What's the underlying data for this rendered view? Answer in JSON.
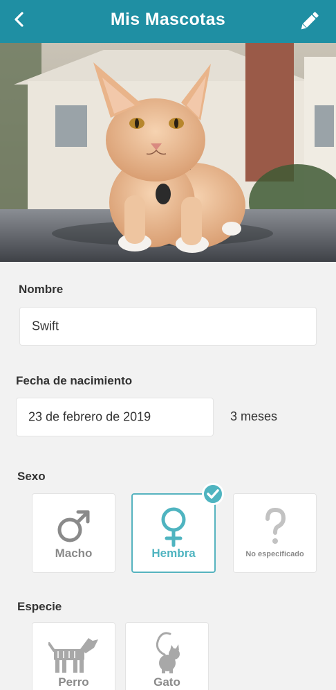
{
  "header": {
    "title": "Mis Mascotas",
    "back_icon": "chevron-left-icon",
    "edit_icon": "pencil-icon",
    "bg_color": "#1f8fa3"
  },
  "photo": {
    "subject": "cat"
  },
  "form": {
    "name": {
      "label": "Nombre",
      "value": "Swift"
    },
    "birth": {
      "label": "Fecha de nacimiento",
      "value": "23 de febrero de 2019",
      "age": "3 meses"
    },
    "sex": {
      "label": "Sexo",
      "selected": "Hembra",
      "options": [
        {
          "label": "Macho",
          "icon": "male-symbol-icon"
        },
        {
          "label": "Hembra",
          "icon": "female-symbol-icon"
        },
        {
          "label": "No especificado",
          "icon": "question-mark-icon"
        }
      ]
    },
    "species": {
      "label": "Especie",
      "options": [
        {
          "label": "Perro",
          "icon": "dog-icon"
        },
        {
          "label": "Gato",
          "icon": "cat-icon"
        }
      ]
    }
  },
  "colors": {
    "accent": "#4fb4c0",
    "muted": "#8a8a8a"
  }
}
